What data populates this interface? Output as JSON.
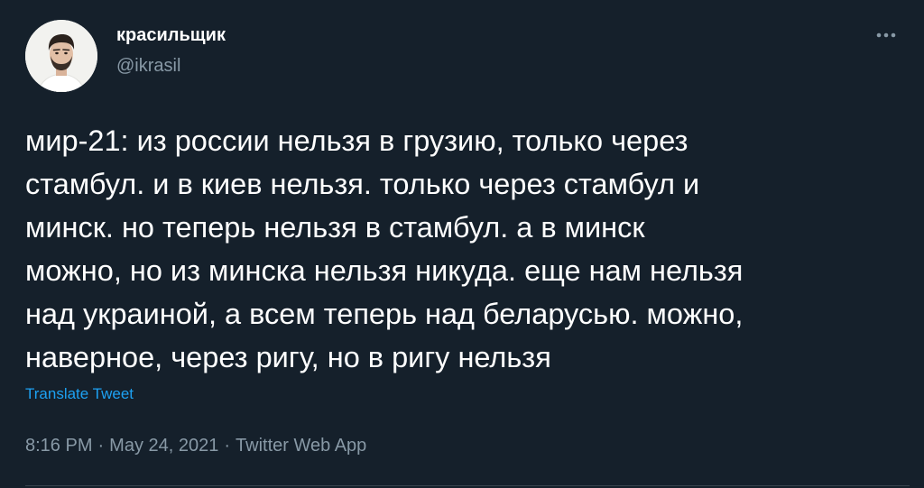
{
  "author": {
    "display_name": "красильщик",
    "handle": "@ikrasil",
    "avatar": "profile-photo"
  },
  "more_icon": "more-horizontal-icon",
  "tweet": {
    "text_lines": [
      "мир-21: из россии нельзя в грузию, только через",
      "стамбул. и в киев нельзя. только через стамбул и",
      "минск. но теперь нельзя в стамбул. а в минск",
      "можно, но из минска нельзя никуда. еще нам нельзя",
      "над украиной, а всем теперь над беларусью. можно,",
      "наверное, через ригу, но в ригу нельзя"
    ],
    "translate_label": "Translate Tweet"
  },
  "meta": {
    "time": "8:16 PM",
    "separator": "·",
    "date": "May 24, 2021",
    "source": "Twitter Web App"
  },
  "colors": {
    "background": "#15202b",
    "text": "#ffffff",
    "secondary": "#8899a6",
    "link": "#1da1f2"
  }
}
